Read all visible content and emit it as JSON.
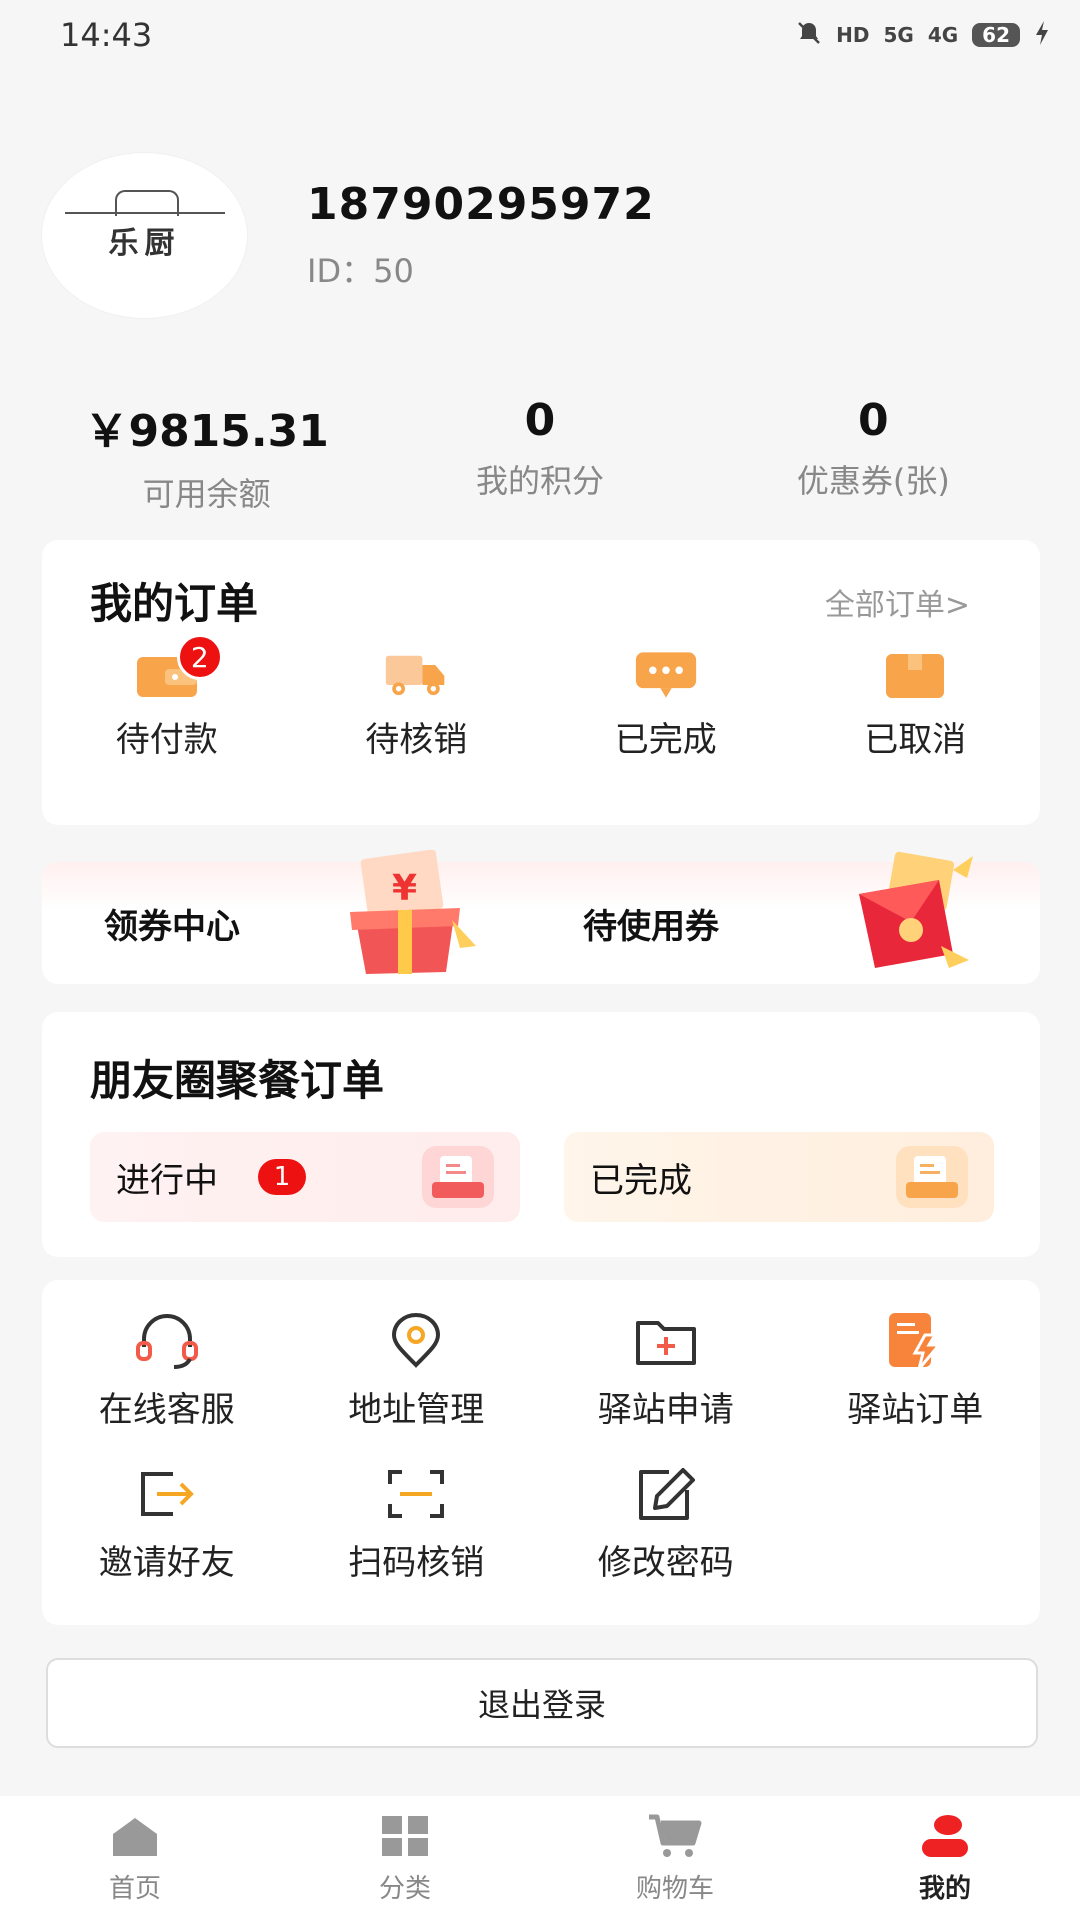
{
  "status_bar": {
    "time": "14:43",
    "hd": "HD",
    "net1": "5G",
    "net2": "4G",
    "battery": "62"
  },
  "profile": {
    "logo_name": "乐厨",
    "phone": "18790295972",
    "id_label": "ID：",
    "id_value": "50"
  },
  "stats": [
    {
      "value": "￥9815.31",
      "label": "可用余额"
    },
    {
      "value": "0",
      "label": "我的积分"
    },
    {
      "value": "0",
      "label": "优惠券(张)"
    }
  ],
  "orders": {
    "title": "我的订单",
    "all_link": "全部订单>",
    "items": [
      {
        "label": "待付款",
        "badge": "2",
        "icon": "wallet-icon"
      },
      {
        "label": "待核销",
        "icon": "truck-icon"
      },
      {
        "label": "已完成",
        "icon": "chat-bubble-icon"
      },
      {
        "label": "已取消",
        "icon": "box-icon"
      }
    ]
  },
  "coupons": {
    "center": "领券中心",
    "pending": "待使用券",
    "currency_mark": "¥"
  },
  "friends": {
    "title": "朋友圈聚餐订单",
    "in_progress": "进行中",
    "in_progress_badge": "1",
    "completed": "已完成"
  },
  "tools": [
    {
      "label": "在线客服",
      "icon": "headset-icon"
    },
    {
      "label": "地址管理",
      "icon": "location-pin-icon"
    },
    {
      "label": "驿站申请",
      "icon": "folder-add-icon"
    },
    {
      "label": "驿站订单",
      "icon": "document-bolt-icon"
    },
    {
      "label": "邀请好友",
      "icon": "share-arrow-icon"
    },
    {
      "label": "扫码核销",
      "icon": "scan-icon"
    },
    {
      "label": "修改密码",
      "icon": "edit-icon"
    }
  ],
  "logout": "退出登录",
  "tabbar": [
    {
      "label": "首页",
      "icon": "home-icon"
    },
    {
      "label": "分类",
      "icon": "grid-icon"
    },
    {
      "label": "购物车",
      "icon": "cart-icon"
    },
    {
      "label": "我的",
      "icon": "user-icon",
      "active": true
    }
  ],
  "colors": {
    "accent": "#ee1111",
    "orange": "#f7a44a",
    "tab_active": "#ee2222",
    "tab_inactive": "#999999"
  }
}
